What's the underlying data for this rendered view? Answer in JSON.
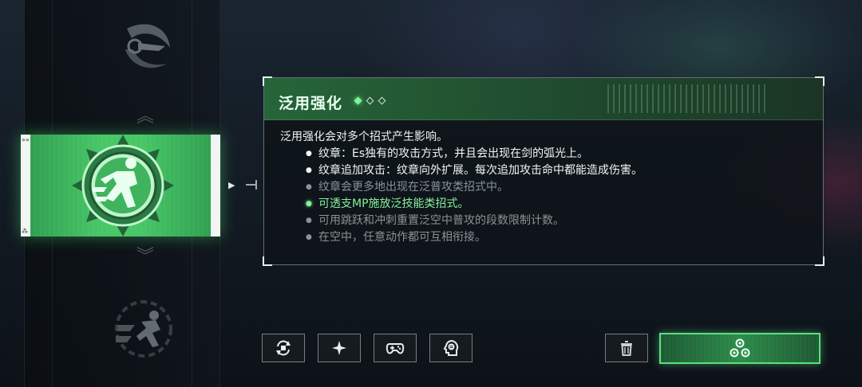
{
  "skill": {
    "title": "泛用强化",
    "level_current": 1,
    "level_max": 3,
    "description": "泛用强化会对多个招式产生影响。",
    "bullets": [
      {
        "text": "纹章：Es独有的攻击方式，并且会出现在剑的弧光上。",
        "state": "strong"
      },
      {
        "text": "纹章追加攻击：纹章向外扩展。每次追加攻击命中都能造成伤害。",
        "state": "strong"
      },
      {
        "text": "纹章会更多地出现在泛普攻类招式中。",
        "state": "dim"
      },
      {
        "text": "可透支MP施放泛技能类招式。",
        "state": "active"
      },
      {
        "text": "可用跳跃和冲刺重置泛空中普攻的段数限制计数。",
        "state": "dim"
      },
      {
        "text": "在空中，任意动作都可互相衔接。",
        "state": "dim"
      }
    ]
  },
  "skill_list": {
    "previous_icon": "crescent-blade-icon",
    "selected_icon": "running-figure-emblem-icon",
    "next_icon": "dash-figure-icon",
    "scroll_up_icon": "double-chevron-up-icon",
    "scroll_down_icon": "double-chevron-down-icon"
  },
  "buttons": [
    {
      "name": "swap-button",
      "icon": "cycle-icon"
    },
    {
      "name": "sparkle-button",
      "icon": "sparkle-icon"
    },
    {
      "name": "controller-button",
      "icon": "gamepad-icon"
    },
    {
      "name": "info-button",
      "icon": "speech-head-icon"
    },
    {
      "name": "delete-button",
      "icon": "trash-icon"
    },
    {
      "name": "confirm-button",
      "icon": "nodes-icon"
    }
  ],
  "colors": {
    "accent_green": "#47c767",
    "active_text": "#86f29a",
    "dim_text": "#8a9396",
    "panel_header": "#2c6e40"
  }
}
